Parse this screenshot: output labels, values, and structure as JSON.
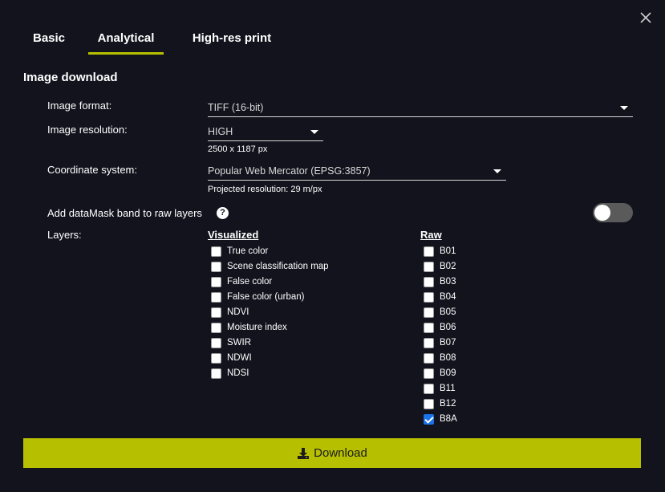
{
  "dialog": {
    "tabs": [
      {
        "label": "Basic",
        "active": false
      },
      {
        "label": "Analytical",
        "active": true
      },
      {
        "label": "High-res print",
        "active": false
      }
    ],
    "section_title": "Image download",
    "accent_color": "#b6bf00",
    "close_icon": "close-icon"
  },
  "form": {
    "image_format": {
      "label": "Image format:",
      "value": "TIFF (16-bit)"
    },
    "image_resolution": {
      "label": "Image resolution:",
      "value": "HIGH",
      "hint": "2500 x 1187 px"
    },
    "coordinate_system": {
      "label": "Coordinate system:",
      "value": "Popular Web Mercator (EPSG:3857)",
      "hint": "Projected resolution: 29 m/px"
    },
    "datamask": {
      "label": "Add dataMask band to raw layers",
      "help_icon": "?",
      "enabled": false
    },
    "layers_label": "Layers:"
  },
  "layers": {
    "visualized": {
      "heading": "Visualized",
      "items": [
        {
          "label": "True color",
          "checked": false
        },
        {
          "label": "Scene classification map",
          "checked": false
        },
        {
          "label": "False color",
          "checked": false
        },
        {
          "label": "False color (urban)",
          "checked": false
        },
        {
          "label": "NDVI",
          "checked": false
        },
        {
          "label": "Moisture index",
          "checked": false
        },
        {
          "label": "SWIR",
          "checked": false
        },
        {
          "label": "NDWI",
          "checked": false
        },
        {
          "label": "NDSI",
          "checked": false
        }
      ]
    },
    "raw": {
      "heading": "Raw",
      "items": [
        {
          "label": "B01",
          "checked": false
        },
        {
          "label": "B02",
          "checked": false
        },
        {
          "label": "B03",
          "checked": false
        },
        {
          "label": "B04",
          "checked": false
        },
        {
          "label": "B05",
          "checked": false
        },
        {
          "label": "B06",
          "checked": false
        },
        {
          "label": "B07",
          "checked": false
        },
        {
          "label": "B08",
          "checked": false
        },
        {
          "label": "B09",
          "checked": false
        },
        {
          "label": "B11",
          "checked": false
        },
        {
          "label": "B12",
          "checked": false
        },
        {
          "label": "B8A",
          "checked": true
        }
      ]
    }
  },
  "download": {
    "label": "Download",
    "icon": "download-icon"
  }
}
